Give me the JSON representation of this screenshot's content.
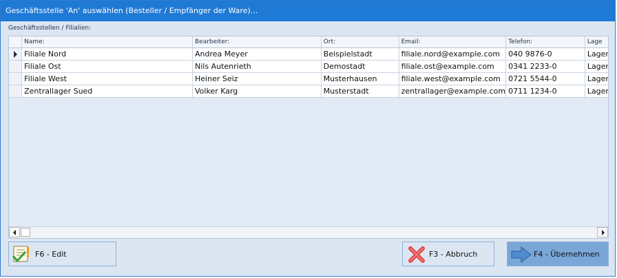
{
  "window": {
    "title": "Geschäftsstelle 'An' auswählen (Besteller / Empfänger der Ware)..."
  },
  "grid": {
    "section_label": "Geschäftsstellen / Filialien:",
    "columns": [
      "Name:",
      "Bearbeiter:",
      "Ort:",
      "Email:",
      "Telefon:",
      "Lage"
    ],
    "rows": [
      {
        "name": "Filiale Nord",
        "bearbeiter": "Andrea Meyer",
        "ort": "Beispielstadt",
        "email": "filiale.nord@example.com",
        "telefon": "040 9876-0",
        "lage": "Lager",
        "selected": true
      },
      {
        "name": "Filiale Ost",
        "bearbeiter": "Nils Autenrieth",
        "ort": "Demostadt",
        "email": "filiale.ost@example.com",
        "telefon": "0341 2233-0",
        "lage": "Lager",
        "selected": false
      },
      {
        "name": "Filiale West",
        "bearbeiter": "Heiner Seiz",
        "ort": "Musterhausen",
        "email": "filiale.west@example.com",
        "telefon": "0721 5544-0",
        "lage": "Lager",
        "selected": false
      },
      {
        "name": "Zentrallager Sued",
        "bearbeiter": "Volker Karg",
        "ort": "Musterstadt",
        "email": "zentrallager@example.com",
        "telefon": "0711 1234-0",
        "lage": "Lager",
        "selected": false
      }
    ]
  },
  "buttons": {
    "edit": "F6 - Edit",
    "cancel": "F3 - Abbruch",
    "ok": "F4 - Übernehmen"
  },
  "icons": {
    "edit": "checklist-edit-icon",
    "cancel": "red-x-icon",
    "ok": "blue-arrow-right-icon"
  },
  "colors": {
    "titlebar": "#1f7ad6",
    "dialog_bg": "#dce6f2",
    "ok_button_bg": "#7aa7d8",
    "cancel_icon": "#e04646"
  }
}
